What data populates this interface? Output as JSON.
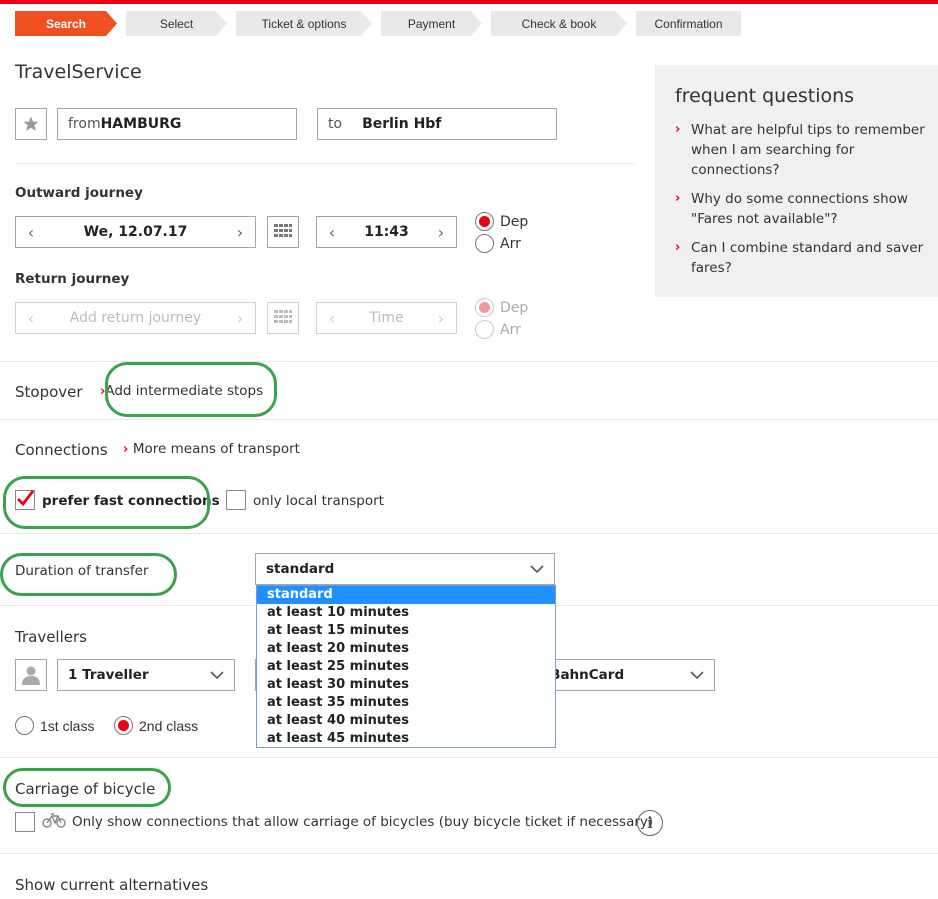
{
  "steps": [
    {
      "label": "Search",
      "active": true
    },
    {
      "label": "Select",
      "active": false
    },
    {
      "label": "Ticket & options",
      "active": false
    },
    {
      "label": "Payment",
      "active": false
    },
    {
      "label": "Check & book",
      "active": false
    },
    {
      "label": "Confirmation",
      "active": false
    }
  ],
  "title": "TravelService",
  "from": {
    "prefix": "from",
    "value": "HAMBURG"
  },
  "to": {
    "prefix": "to",
    "value": "Berlin Hbf"
  },
  "outward": {
    "label": "Outward journey",
    "date": "We, 12.07.17",
    "time": "11:43",
    "dep": "Dep",
    "arr": "Arr",
    "selected": "Dep"
  },
  "return": {
    "label": "Return journey",
    "date_placeholder": "Add return journey",
    "time_placeholder": "Time",
    "dep": "Dep",
    "arr": "Arr"
  },
  "stopover": {
    "label": "Stopover",
    "link": "Add intermediate stops"
  },
  "connections": {
    "label": "Connections",
    "link": "More means of transport",
    "fast": "prefer fast connections",
    "fast_checked": true,
    "local": "only local transport",
    "local_checked": false
  },
  "transfer": {
    "label": "Duration of transfer",
    "selected": "standard",
    "options": [
      "standard",
      "at least 10 minutes",
      "at least 15 minutes",
      "at least 20 minutes",
      "at least 25 minutes",
      "at least 30 minutes",
      "at least 35 minutes",
      "at least 40 minutes",
      "at least 45 minutes"
    ]
  },
  "travellers": {
    "label": "Travellers",
    "count": "1 Traveller",
    "bahncard_visible": "t BahnCard",
    "first": "1st class",
    "second": "2nd class",
    "selected_class": "2nd class"
  },
  "bicycle": {
    "label": "Carriage of bicycle",
    "text": "Only show connections that allow carriage of bicycles (buy bicycle ticket if necessary)",
    "checked": false
  },
  "alternatives": {
    "label": "Show current alternatives"
  },
  "faq": {
    "title": "frequent questions",
    "items": [
      "What are helpful tips to remember when I am searching for connections?",
      "Why do some connections show \"Fares not available\"?",
      "Can I combine standard and saver fares?"
    ]
  },
  "colors": {
    "accent": "#ec0016",
    "step_active": "#f0501f",
    "highlight_ring": "#39a34a",
    "dropdown_selected": "#1e90ff",
    "faq_bg": "#f0f0f0"
  },
  "icons": [
    "star-icon",
    "calendar-grid-icon",
    "chevron-left-icon",
    "chevron-right-icon",
    "chevron-down-icon",
    "person-icon",
    "bicycle-icon",
    "info-icon"
  ]
}
